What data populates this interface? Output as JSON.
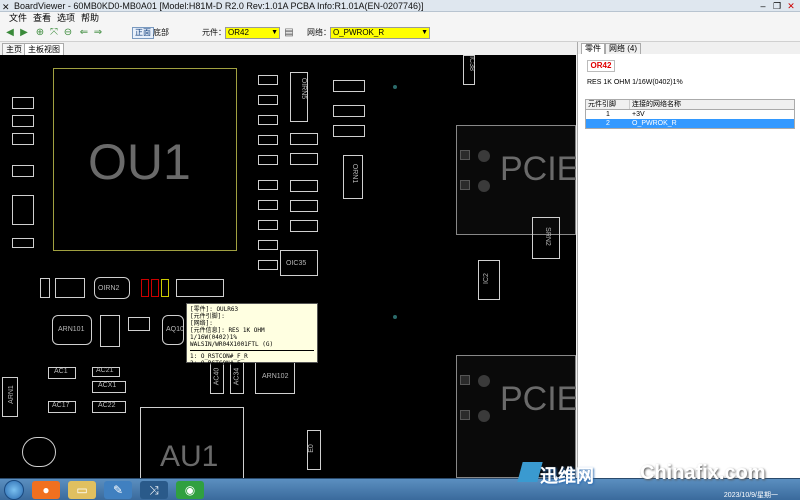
{
  "window": {
    "title": "BoardViewer  -  60MB0KD0-MB0A01 [Model:H81M-D R2.0 Rev:1.01A PCBA Info:R1.01A(EN-0207746)]",
    "app_icon": "boardviewer-icon"
  },
  "menu": [
    "文件",
    "查看",
    "选项",
    "帮助"
  ],
  "toolbar": {
    "side_top": "正面",
    "side_bottom": "底部",
    "component_label": "元件：",
    "component_value": "OR42",
    "net_label": "网络：",
    "net_value": "O_PWROK_R"
  },
  "tabs": [
    "主页",
    "主板视图"
  ],
  "board": {
    "big_labels": [
      "OU1",
      "PCIE",
      "PCIE",
      "AU1"
    ],
    "small_labels": [
      "OIRN2",
      "ARN101",
      "AQ10",
      "OIRN5",
      "ORN1",
      "SRN2",
      "IC2",
      "IC38",
      "OIC35",
      "AC1",
      "AC17",
      "AC22",
      "AC21",
      "AC40",
      "ARN102",
      "ARN1",
      "E0",
      "AC34",
      "ACX1"
    ]
  },
  "tooltip": {
    "line1": "[零件]: OULR63",
    "line2": "[元件引脚]:",
    "line3": "[网络]:",
    "line4": "[元件信息]: RES 1K OHM 1/16W(0402)1%",
    "line5": "WALSIN/WR04X1001FTL              (G)",
    "pin1": "1: O_RSTCON#_F_R",
    "pin2": "2: O_RSTCON#_F"
  },
  "panel": {
    "tabs": [
      "零件",
      "网络 (4)"
    ],
    "component": "OR42",
    "description": "RES 1K OHM 1/16W(0402)1%",
    "table": {
      "headers": [
        "元件引脚",
        "连接的网络名称"
      ],
      "rows": [
        {
          "pin": "1",
          "net": "+3V",
          "selected": false
        },
        {
          "pin": "2",
          "net": "O_PWROK_R",
          "selected": true
        }
      ]
    }
  },
  "taskbar": {
    "clock": "2023/10/9/星期一"
  },
  "watermark": {
    "cn": "迅维网",
    "en": "Chinafix.com"
  }
}
